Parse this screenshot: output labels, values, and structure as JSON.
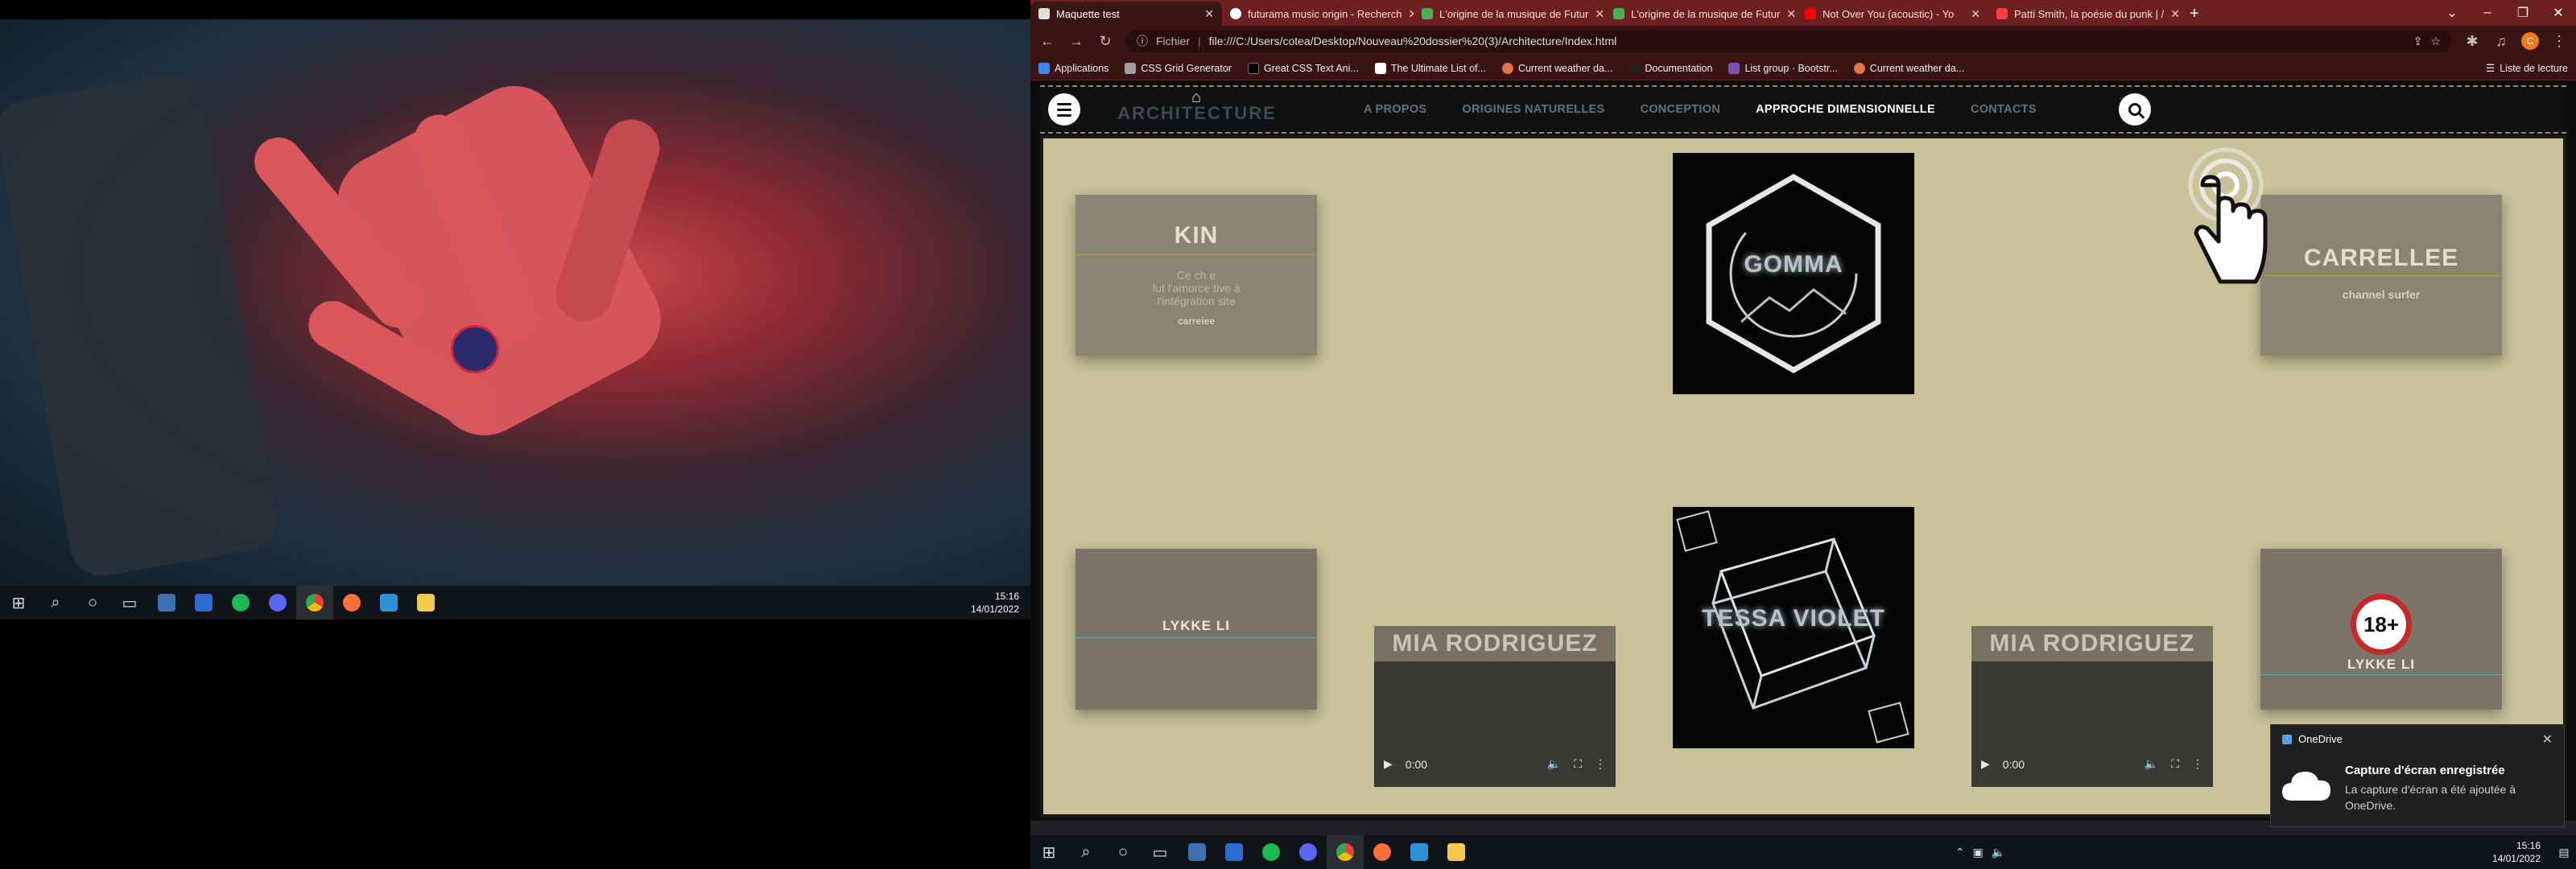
{
  "left_screen": {
    "taskbar": {
      "time": "15:16",
      "date": "14/01/2022",
      "apps": [
        "windows-start",
        "search",
        "cortana",
        "task-view",
        "calculator",
        "photos",
        "spotify",
        "discord",
        "chrome",
        "firefox",
        "vscode",
        "file-explorer"
      ]
    }
  },
  "browser": {
    "tabs": [
      {
        "label": "Maquette test",
        "active": true,
        "favicon_color": "#e0e0e0"
      },
      {
        "label": "futurama music origin - Recherch",
        "active": false,
        "favicon_color": "#ffffff"
      },
      {
        "label": "L'origine de la musique de Futur",
        "active": false,
        "favicon_color": "#4caf50"
      },
      {
        "label": "L'origine de la musique de Futur",
        "active": false,
        "favicon_color": "#4caf50"
      },
      {
        "label": "Not Over You (acoustic) - Yo",
        "active": false,
        "favicon_color": "#ff0000"
      },
      {
        "label": "Patti Smith, la poésie du punk | /",
        "active": false,
        "favicon_color": "#ff3b3b"
      }
    ],
    "new_tab": "+",
    "address": {
      "scheme_label": "Fichier",
      "url": "file:///C:/Users/cotea/Desktop/Nouveau%20dossier%20(3)/Architecture/Index.html",
      "profile_initial": "C"
    },
    "bookmarks": [
      {
        "label": "Applications",
        "color": "#4285f4"
      },
      {
        "label": "CSS Grid Generator",
        "color": "#9e9e9e"
      },
      {
        "label": "Great CSS Text Ani...",
        "color": "#000000"
      },
      {
        "label": "The Ultimate List of...",
        "color": "#ffffff"
      },
      {
        "label": "Current weather da...",
        "color": "#e57348"
      },
      {
        "label": "Documentation",
        "color": "#222222"
      },
      {
        "label": "List group · Bootstr...",
        "color": "#7952b3"
      },
      {
        "label": "Current weather da...",
        "color": "#e57348"
      }
    ],
    "reading_list": "Liste de lecture"
  },
  "site": {
    "logo_text": "ARCHITECTURE",
    "nav": [
      {
        "label": "A PROPOS",
        "current": false
      },
      {
        "label": "ORIGINES NATURELLES",
        "current": false
      },
      {
        "label": "CONCEPTION",
        "current": false
      },
      {
        "label": "APPROCHE DIMENSIONNELLE",
        "current": true
      },
      {
        "label": "CONTACTS",
        "current": false
      }
    ],
    "cards": {
      "kin": {
        "title": "KIN",
        "desc_line1": "Ce ch",
        "desc_line1b": "e",
        "desc_line2": "fut l'amorce",
        "desc_line2b": "tive à",
        "desc_line3": "l'intégration",
        "desc_line3b": "site",
        "sub": "carreiee"
      },
      "gomma": {
        "title": "GOMMA"
      },
      "carrellee": {
        "title": "CARRELLEE",
        "sub": "channel surfer"
      },
      "lykke_left": {
        "title": "LYKKE LI"
      },
      "mia_left": {
        "title": "MIA RODRIGUEZ",
        "time": "0:00"
      },
      "tessa": {
        "title": "TESSA VIOLET"
      },
      "mia_right": {
        "title": "MIA RODRIGUEZ",
        "time": "0:00"
      },
      "lykke_right": {
        "title": "LYKKE LI",
        "badge": "18+"
      }
    }
  },
  "notification": {
    "app": "OneDrive",
    "title": "Capture d'écran enregistrée",
    "message": "La capture d'écran a été ajoutée à OneDrive."
  },
  "right_taskbar": {
    "time": "15:16",
    "date": "14/01/2022"
  }
}
